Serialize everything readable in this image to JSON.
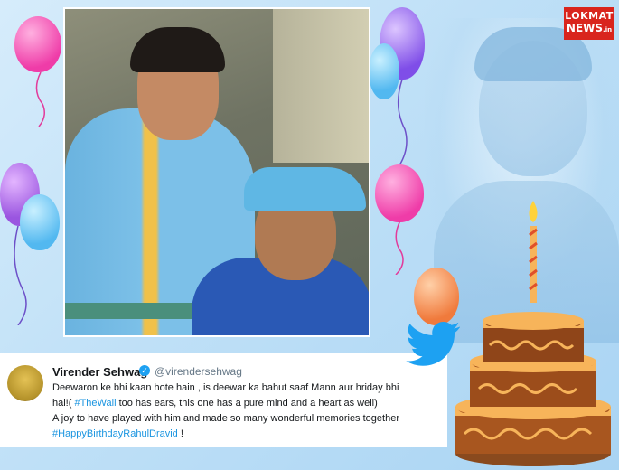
{
  "brand": {
    "logo_line1": "LOKMAT",
    "logo_line2": "NEWS",
    "logo_suffix": ".in",
    "accent": "#d9251d"
  },
  "tweet": {
    "name": "Virender Sehwag",
    "verified_mark": "✓",
    "handle": "@virendersehwag",
    "line1": "Deewaron ke bhi kaan hote hain , is deewar ka bahut saaf Mann aur hriday bhi",
    "line2_prefix": "hai!( ",
    "line2_tag": "#TheWall",
    "line2_suffix": " too has ears, this one has a pure mind and a heart as well)",
    "line3": "A joy to have played with him and made so many wonderful memories together",
    "line4_tag": "#HappyBirthdayRahulDravid",
    "line4_suffix": " !"
  },
  "icons": {
    "twitter": "twitter-bird-icon",
    "cake": "birthday-cake-icon",
    "balloons": "balloon-icon"
  },
  "colors": {
    "background": "#bfe0f7",
    "link": "#1b95e0",
    "verified": "#1da1f2"
  }
}
